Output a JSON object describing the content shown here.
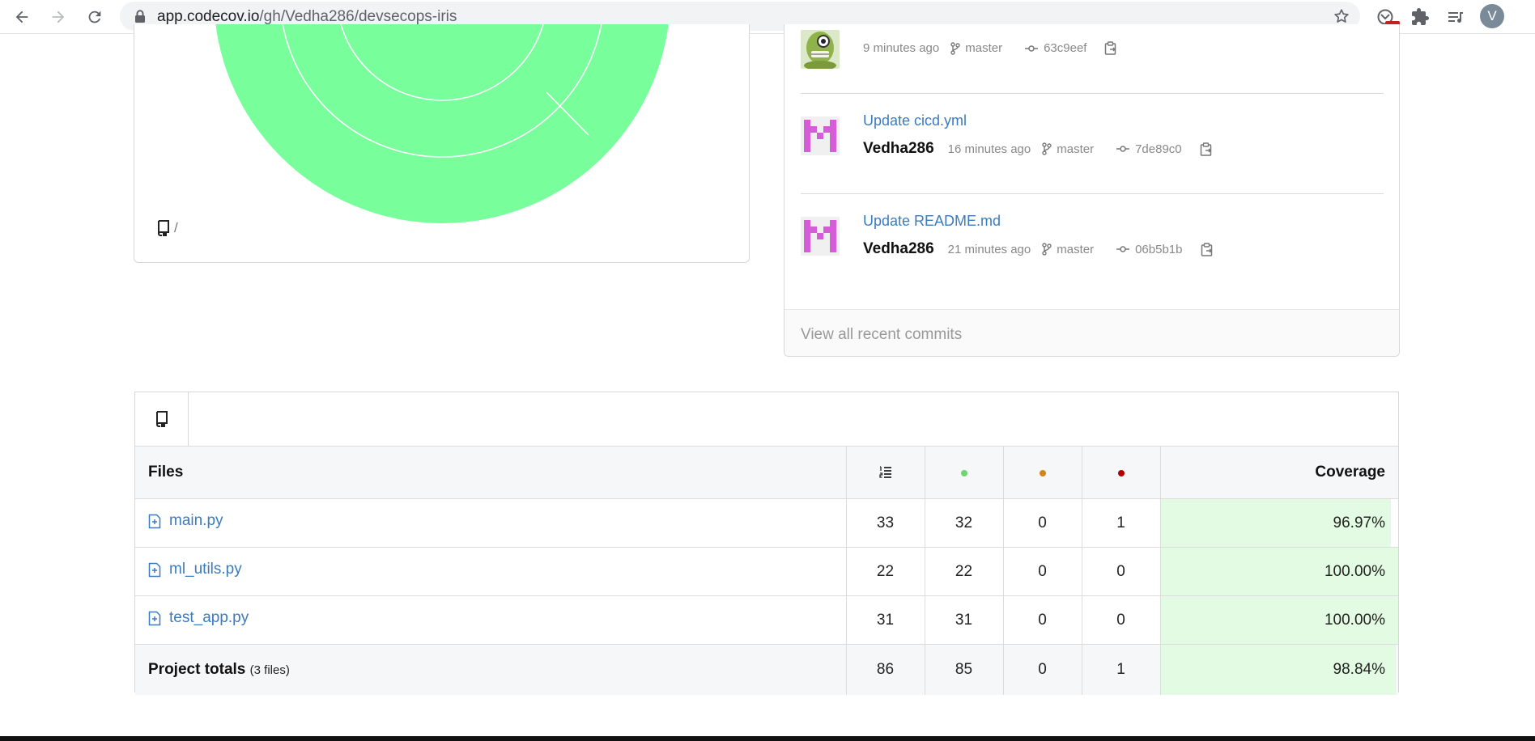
{
  "browser": {
    "url_host": "app.codecov.io",
    "url_path": "/gh/Vedha286/devsecops-iris",
    "avatar_letter": "V",
    "icons": [
      "back-arrow-icon",
      "forward-arrow-icon",
      "reload-icon",
      "lock-icon",
      "bookmark-star-icon",
      "extension-icon",
      "puzzle-icon",
      "media-queue-icon"
    ]
  },
  "sunburst": {
    "path_label": "/",
    "fill_color": "#78ff9c"
  },
  "commits": {
    "items": [
      {
        "title": "",
        "author": "",
        "time": "9 minutes ago",
        "branch": "master",
        "sha": "63c9eef",
        "avatar": "monster"
      },
      {
        "title": "Update cicd.yml",
        "author": "Vedha286",
        "time": "16 minutes ago",
        "branch": "master",
        "sha": "7de89c0",
        "avatar": "identicon"
      },
      {
        "title": "Update README.md",
        "author": "Vedha286",
        "time": "21 minutes ago",
        "branch": "master",
        "sha": "06b5b1b",
        "avatar": "identicon"
      }
    ],
    "view_all": "View all recent commits"
  },
  "files": {
    "headers": {
      "files": "Files",
      "coverage": "Coverage"
    },
    "status_colors": {
      "hit": "#6fd36f",
      "partial": "#d0861a",
      "miss": "#b20000"
    },
    "rows": [
      {
        "name": "main.py",
        "lines": "33",
        "hits": "32",
        "partials": "0",
        "misses": "1",
        "coverage": "96.97%",
        "coverage_value": 96.97
      },
      {
        "name": "ml_utils.py",
        "lines": "22",
        "hits": "22",
        "partials": "0",
        "misses": "0",
        "coverage": "100.00%",
        "coverage_value": 100.0
      },
      {
        "name": "test_app.py",
        "lines": "31",
        "hits": "31",
        "partials": "0",
        "misses": "0",
        "coverage": "100.00%",
        "coverage_value": 100.0
      }
    ],
    "totals": {
      "label": "Project totals",
      "sub": "(3 files)",
      "lines": "86",
      "hits": "85",
      "partials": "0",
      "misses": "1",
      "coverage": "98.84%",
      "coverage_value": 98.84
    }
  }
}
